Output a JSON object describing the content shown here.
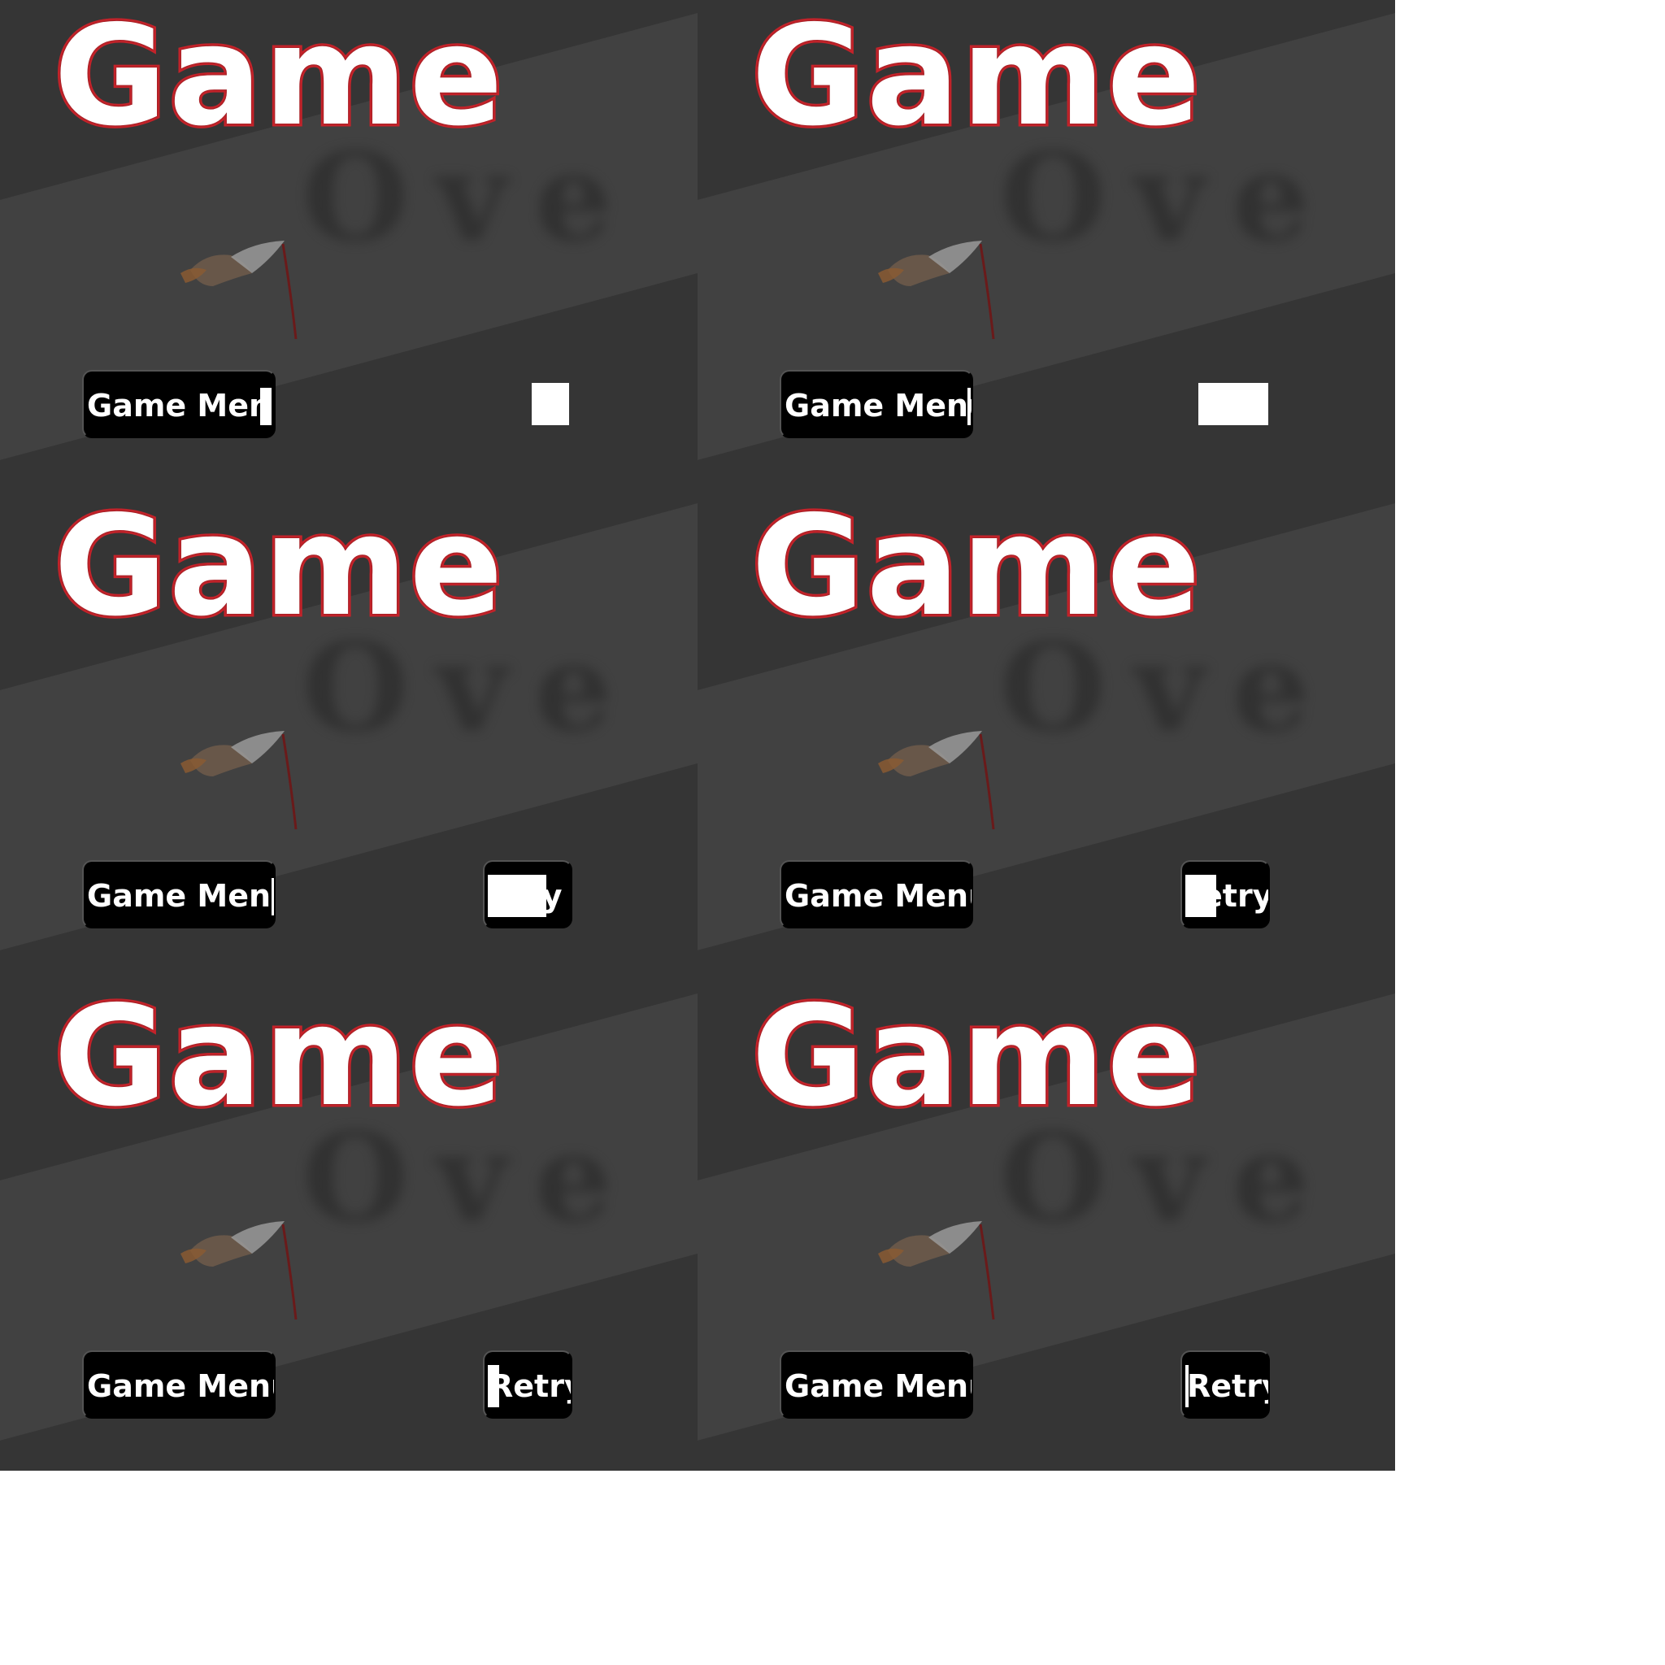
{
  "screen": {
    "title": "Game",
    "ghost_title": "Ove",
    "menu_button_label": "Game Menu",
    "retry_button_label": "Retry"
  },
  "colors": {
    "background": "#353535",
    "stripe": "#414141",
    "title_fill": "#ffffff",
    "title_outline": "#c4232a",
    "button_bg": "#000000",
    "button_text": "#ffffff"
  },
  "icons": {
    "mascot": "fallen-figure-icon"
  },
  "frames": [
    {
      "menu_visible_chars": "Game Men",
      "retry_visible_chars": ""
    },
    {
      "menu_visible_chars": "Game Menu",
      "retry_visible_chars": ""
    },
    {
      "menu_visible_chars": "Game Menu",
      "retry_visible_chars": "ry"
    },
    {
      "menu_visible_chars": "Game Menu",
      "retry_visible_chars": "etry"
    },
    {
      "menu_visible_chars": "Game Menu",
      "retry_visible_chars": "Retry"
    },
    {
      "menu_visible_chars": "Game Menu",
      "retry_visible_chars": "Retry"
    }
  ]
}
